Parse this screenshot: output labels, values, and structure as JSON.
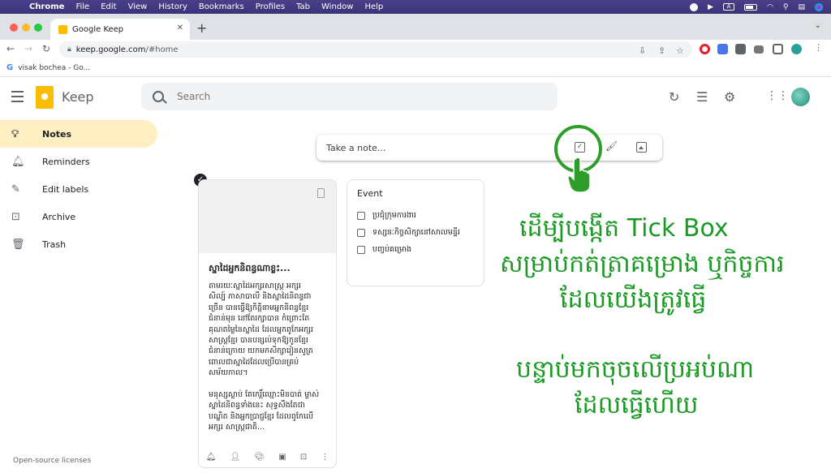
{
  "menubar": {
    "app": "Chrome",
    "items": [
      "File",
      "Edit",
      "View",
      "History",
      "Bookmarks",
      "Profiles",
      "Tab",
      "Window",
      "Help"
    ],
    "status_box_label": "A"
  },
  "browser": {
    "tab_title": "Google Keep",
    "url_host": "keep.google.com",
    "url_path": "/#home",
    "bookmark": "visak bochea - Go..."
  },
  "keep": {
    "app_title": "Keep",
    "search_placeholder": "Search",
    "sidebar": [
      {
        "label": "Notes",
        "icon": "lightbulb-icon",
        "active": true
      },
      {
        "label": "Reminders",
        "icon": "bell-icon",
        "active": false
      },
      {
        "label": "Edit labels",
        "icon": "pencil-icon",
        "active": false
      },
      {
        "label": "Archive",
        "icon": "archive-icon",
        "active": false
      },
      {
        "label": "Trash",
        "icon": "trash-icon",
        "active": false
      }
    ],
    "take_note_label": "Take a note...",
    "footer_link": "Open-source licenses",
    "notes": [
      {
        "title": "ស្នាដៃអ្នកនិពន្ធណាខ្លះ...",
        "body": "តាមរយៈស្នាដៃអក្សរសាស្ត្រ អក្សរ\nសិល្ប៍ ភាសាបាលី និងស្នាដៃនិពន្ធជា\nច្រើន បានធ្វើឱ្យកិត្តិនាមអ្នកនិពន្ធខ្មែរ\nជំនាន់មុន នៅតែរក្សាបាន កំព្រោះតែ\nគុណតម្លៃនៃស្នាដៃ ដែលអ្នកពូកែអក្សរ\nសាស្ត្រខ្មែរ បានបន្សល់ទុកឱ្យកូនខ្មែរ\nជំនាន់ក្រោយ យកមកសិក្សារៀនសូត្រ\nពោលជាស្នាដៃដែលប្រើបានគ្រប់\nសម័យកាល។\n\nមនុស្សស្លាប់ តែកេរ្តិ៍ឈ្មោះមិនបាត់ ម្ចាស់\nស្នាដៃនិពន្ធទាំងនេះ សុទ្ធសឹងតែជា\nបណ្ឌិត និងអ្នកប្រាជ្ញខ្មែរ ដែលពូកែលើ\nអក្សរ សាស្ត្រជាតិ..."
      },
      {
        "title": "Event",
        "items": [
          "ប្រជុំក្រុមការងារ",
          "ទស្សនៈកិច្ចសិក្សានៅសាលមន្ទីរ",
          "បញ្ចប់គម្រោង"
        ]
      }
    ]
  },
  "captions": {
    "line1": "ដើម្បីបង្កើត Tick Box",
    "line2": "សម្រាប់កត់ត្រាគម្រោង ឬកិច្ចការ",
    "line3": "ដែលយើងត្រូវធ្វើ",
    "line4": "បន្ទាប់មកចុចលើប្រអប់ណា",
    "line5": "ដែលធ្វើហើយ"
  },
  "colors": {
    "accent_green": "#1a9a24",
    "active_nav": "#feefc3",
    "keep_yellow": "#fbbc04"
  }
}
